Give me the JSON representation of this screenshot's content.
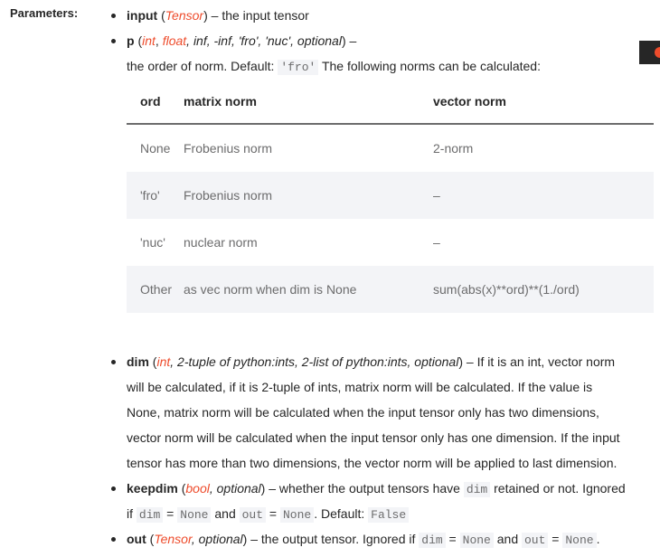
{
  "section_label": "Parameters:",
  "input": {
    "name": "input",
    "type": "Tensor",
    "desc": " – the input tensor"
  },
  "p": {
    "name": "p",
    "type_red1": "int",
    "type_red2": "float",
    "type_rest": ", inf, -inf, 'fro', 'nuc', optional",
    "dash": " –",
    "desc1": "the order of norm. Default: ",
    "default_code": "'fro'",
    "desc2": " The following norms can be calculated:"
  },
  "norm_table": {
    "headers": [
      "ord",
      "matrix norm",
      "vector norm"
    ],
    "rows": [
      [
        "None",
        "Frobenius norm",
        "2-norm"
      ],
      [
        "'fro'",
        "Frobenius norm",
        "–"
      ],
      [
        "'nuc'",
        "nuclear norm",
        "–"
      ],
      [
        "Other",
        "as vec norm when dim is None",
        "sum(abs(x)**ord)**(1./ord)"
      ]
    ]
  },
  "dim": {
    "name": "dim",
    "type_red": "int",
    "type_rest": ", 2-tuple of python:ints, 2-list of python:ints, optional",
    "line1_desc": " – If it is an int, vector norm",
    "line2": "will be calculated, if it is 2-tuple of ints, matrix norm will be calculated. If the value is",
    "line3": "None, matrix norm will be calculated when the input tensor only has two dimensions,",
    "line4": "vector norm will be calculated when the input tensor only has one dimension. If the input",
    "line5": "tensor has more than two dimensions, the vector norm will be applied to last dimension."
  },
  "keepdim": {
    "name": "keepdim",
    "type_red": "bool",
    "type_rest": ", optional",
    "desc1": " – whether the output tensors have ",
    "code1": "dim",
    "desc2": " retained or not. Ignored",
    "l2_if": "if ",
    "l2_code_dim": "dim",
    "l2_eq1": " = ",
    "l2_code_none1": "None",
    "l2_and": " and ",
    "l2_code_out": "out",
    "l2_eq2": " = ",
    "l2_code_none2": "None",
    "l2_default": ". Default: ",
    "l2_code_false": "False"
  },
  "out": {
    "name": "out",
    "type_red": "Tensor",
    "type_rest": ", optional",
    "desc1": " – the output tensor. Ignored if ",
    "code_dim": "dim",
    "eq1": " = ",
    "code_none1": "None",
    "and": " and ",
    "code_out": "out",
    "eq2": " = ",
    "code_none2": "None",
    "end": "."
  },
  "colors": {
    "accent": "#ee4c2c",
    "text": "#262626",
    "muted": "#6c6c6d",
    "code_bg": "#f3f4f7"
  }
}
